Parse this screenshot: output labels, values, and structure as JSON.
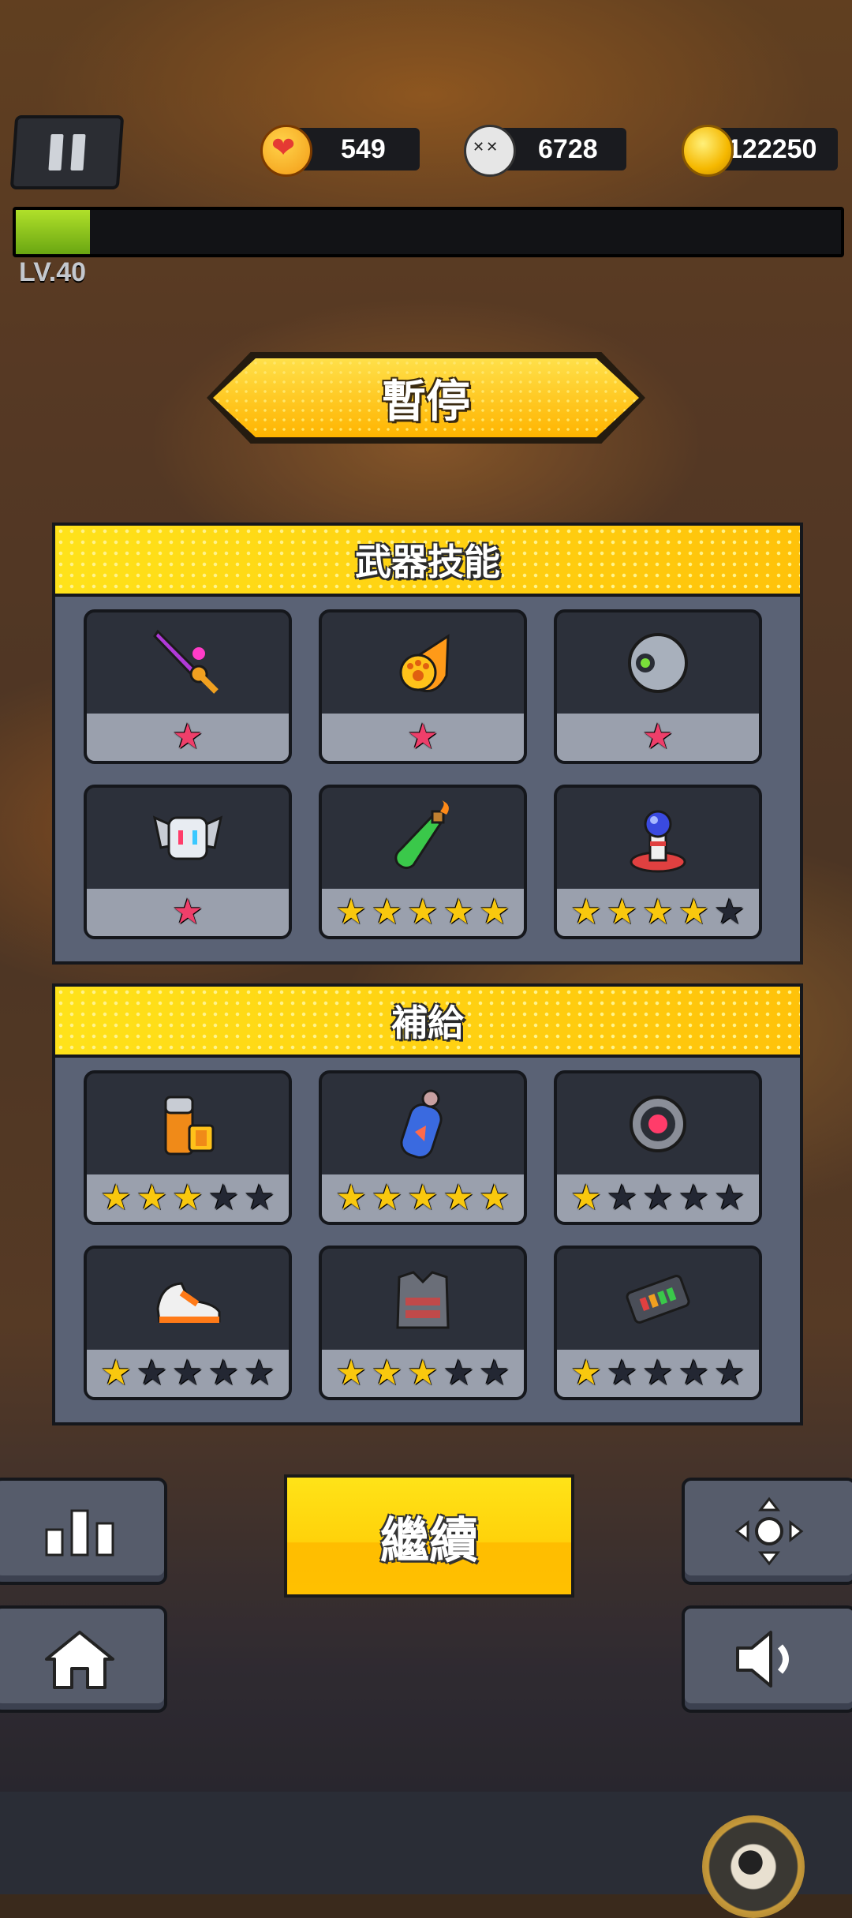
{
  "hud": {
    "lives": "549",
    "kills": "6728",
    "coins": "122250",
    "level": "LV.40",
    "xp_fraction": 0.09
  },
  "title": "暫停",
  "weapon_panel": {
    "title": "武器技能",
    "items": [
      {
        "icon": "purple-sword-icon",
        "stars": 1,
        "max": 1,
        "color": "#ee3f6a"
      },
      {
        "icon": "paw-fireball-icon",
        "stars": 1,
        "max": 1,
        "color": "#ee3f6a"
      },
      {
        "icon": "orb-drone-icon",
        "stars": 1,
        "max": 1,
        "color": "#ee3f6a"
      },
      {
        "icon": "robot-drone-icon",
        "stars": 1,
        "max": 1,
        "color": "#ee3f6a"
      },
      {
        "icon": "molotov-bottle-icon",
        "stars": 5,
        "max": 5,
        "color": "#f9c80e"
      },
      {
        "icon": "tesla-coil-icon",
        "stars": 4,
        "max": 5,
        "color": "#f9c80e"
      }
    ]
  },
  "supply_panel": {
    "title": "補給",
    "items": [
      {
        "icon": "battery-icon",
        "stars": 3,
        "max": 5
      },
      {
        "icon": "oxygen-canister-icon",
        "stars": 5,
        "max": 5
      },
      {
        "icon": "magnet-core-icon",
        "stars": 1,
        "max": 5
      },
      {
        "icon": "sneaker-icon",
        "stars": 1,
        "max": 5
      },
      {
        "icon": "armor-vest-icon",
        "stars": 3,
        "max": 5
      },
      {
        "icon": "energy-chip-icon",
        "stars": 1,
        "max": 5
      }
    ]
  },
  "buttons": {
    "continue": "繼續"
  },
  "colors": {
    "accent": "#ffd20a",
    "panel": "#5a6275",
    "star_on": "#f9c80e",
    "star_off": "#232733"
  }
}
